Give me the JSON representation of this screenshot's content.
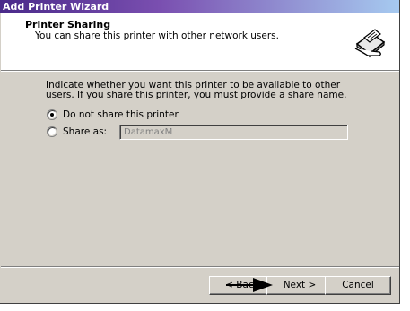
{
  "window": {
    "title": "Add Printer Wizard"
  },
  "header": {
    "title": "Printer Sharing",
    "subtitle": "You can share this printer with other network users.",
    "icon": "printer-share-icon"
  },
  "body": {
    "description": "Indicate whether you want this printer to be available to other users. If you share this printer, you must provide a share name.",
    "options": [
      {
        "label": "Do not share this printer",
        "selected": true
      },
      {
        "label": "Share as:",
        "selected": false
      }
    ],
    "share_name": {
      "value": "DatamaxM",
      "enabled": false
    }
  },
  "buttons": {
    "back": "< Back",
    "next": "Next >",
    "cancel": "Cancel"
  },
  "colors": {
    "title_bar_start": "#4a2a8a",
    "title_bar_end": "#a6caf0",
    "face": "#d4d0c8"
  }
}
